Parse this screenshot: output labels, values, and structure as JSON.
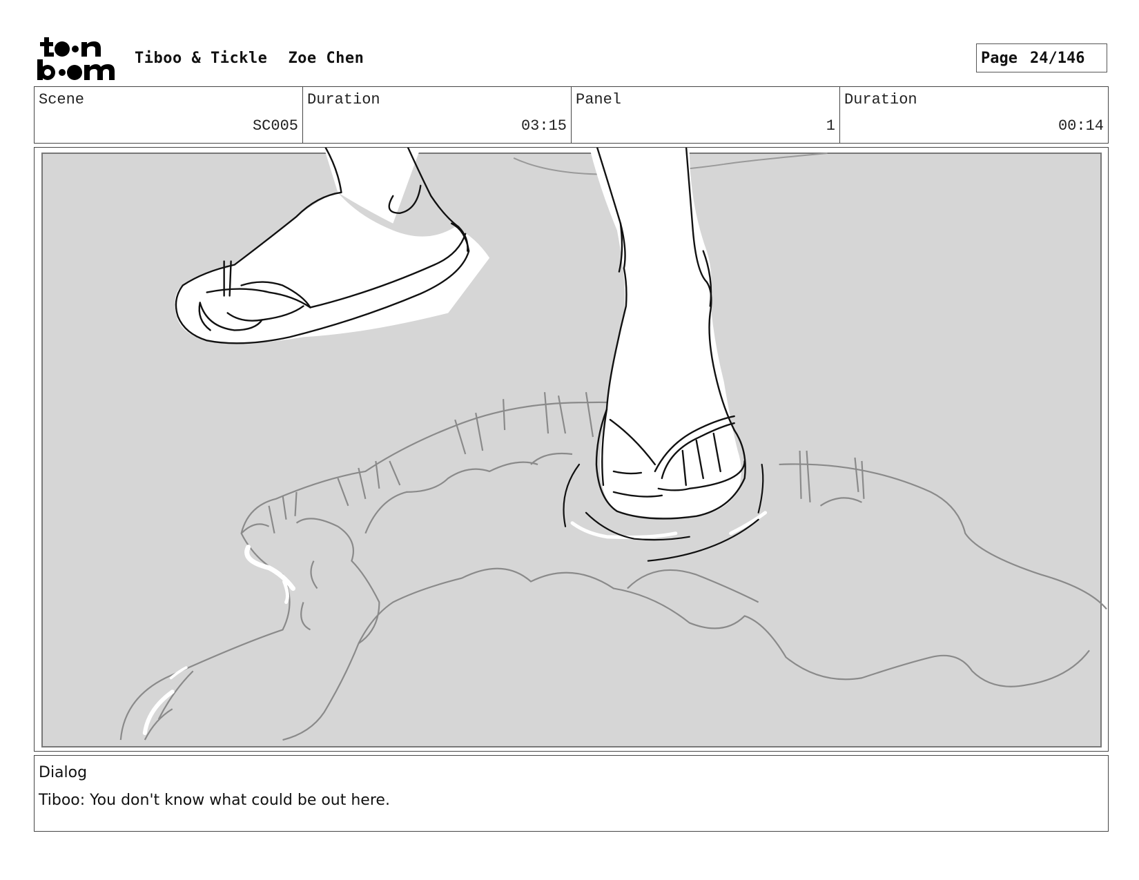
{
  "header": {
    "logo_name": "toon boom logo",
    "project": "Tiboo & Tickle",
    "artist": "Zoe Chen",
    "page_label": "Page",
    "page_number": "24/146"
  },
  "info": {
    "scene_label": "Scene",
    "scene_value": "SC005",
    "scene_duration_label": "Duration",
    "scene_duration_value": "03:15",
    "panel_label": "Panel",
    "panel_value": "1",
    "panel_duration_label": "Duration",
    "panel_duration_value": "00:14"
  },
  "panel": {
    "background_color": "#d6d6d6",
    "line_color": "#111111",
    "puddle_line_color": "#8a8a8a",
    "highlight_color": "#ffffff"
  },
  "dialog": {
    "label": "Dialog",
    "text": "Tiboo: You don't know what could be out here."
  }
}
